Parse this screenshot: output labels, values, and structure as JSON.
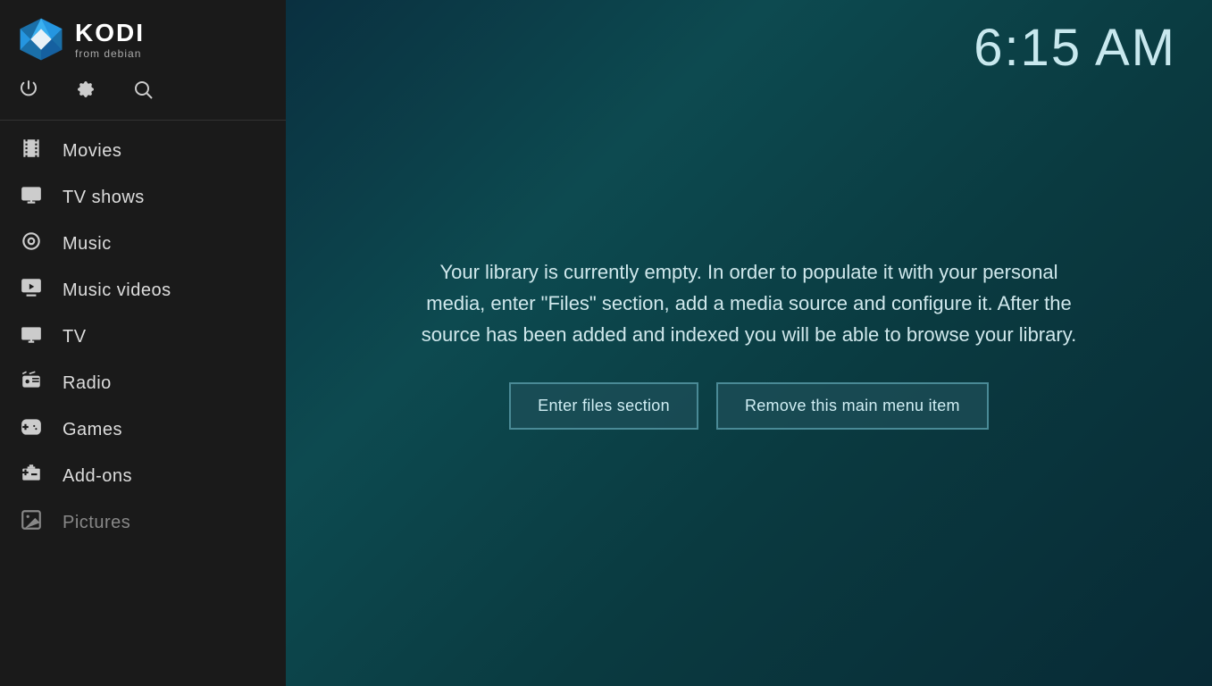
{
  "sidebar": {
    "logo_alt": "Kodi logo",
    "app_name": "KODI",
    "app_subtitle": "from debian",
    "controls": {
      "power": "⏻",
      "settings": "⚙",
      "search": "🔍"
    },
    "menu_items": [
      {
        "id": "movies",
        "label": "Movies",
        "icon": "movies"
      },
      {
        "id": "tv-shows",
        "label": "TV shows",
        "icon": "tv-shows"
      },
      {
        "id": "music",
        "label": "Music",
        "icon": "music"
      },
      {
        "id": "music-videos",
        "label": "Music videos",
        "icon": "music-videos"
      },
      {
        "id": "tv",
        "label": "TV",
        "icon": "tv"
      },
      {
        "id": "radio",
        "label": "Radio",
        "icon": "radio"
      },
      {
        "id": "games",
        "label": "Games",
        "icon": "games"
      },
      {
        "id": "add-ons",
        "label": "Add-ons",
        "icon": "add-ons"
      },
      {
        "id": "pictures",
        "label": "Pictures",
        "icon": "pictures",
        "dimmed": true
      }
    ]
  },
  "main": {
    "clock": "6:15 AM",
    "message": "Your library is currently empty. In order to populate it with your personal media, enter \"Files\" section, add a media source and configure it. After the source has been added and indexed you will be able to browse your library.",
    "buttons": {
      "enter_files": "Enter files section",
      "remove_item": "Remove this main menu item"
    }
  }
}
